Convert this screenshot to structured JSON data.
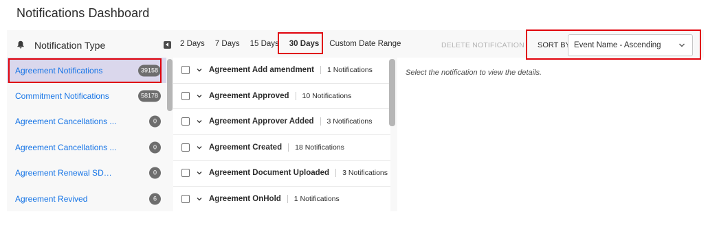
{
  "page": {
    "title": "Notifications Dashboard"
  },
  "left": {
    "header": "Notification Type",
    "items": [
      {
        "label": "Agreement Notifications",
        "count": "39158",
        "selected": true
      },
      {
        "label": "Commitment Notifications",
        "count": "58178"
      },
      {
        "label": "Agreement Cancellations ...",
        "count": "0"
      },
      {
        "label": "Agreement Cancellations ...",
        "count": "0"
      },
      {
        "label": "Agreement Renewal SDK ...",
        "count": "0"
      },
      {
        "label": "Agreement Revived",
        "count": "6"
      }
    ]
  },
  "filters": {
    "date_tabs": [
      "2 Days",
      "7 Days",
      "15 Days",
      "30 Days",
      "Custom Date Range"
    ],
    "active_tab": "30 Days"
  },
  "toolbar": {
    "delete_label": "DELETE NOTIFICATION",
    "sort_label": "SORT BY",
    "sort_value": "Event Name - Ascending"
  },
  "events": [
    {
      "name": "Agreement Add amendment",
      "count": "1 Notifications"
    },
    {
      "name": "Agreement Approved",
      "count": "10 Notifications"
    },
    {
      "name": "Agreement Approver Added",
      "count": "3 Notifications"
    },
    {
      "name": "Agreement Created",
      "count": "18 Notifications"
    },
    {
      "name": "Agreement Document Uploaded",
      "count": "3 Notifications"
    },
    {
      "name": "Agreement OnHold",
      "count": "1 Notifications"
    }
  ],
  "detail": {
    "hint": "Select the notification to view the details."
  },
  "colors": {
    "link": "#1473e6",
    "selected_bg": "#dad7ec",
    "highlight": "#e0000a"
  },
  "icons": {
    "header": "bell-icon",
    "collapse": "collapse-left-icon",
    "row_toggle": "chevron-down-icon",
    "select_arrow": "chevron-down-icon"
  }
}
